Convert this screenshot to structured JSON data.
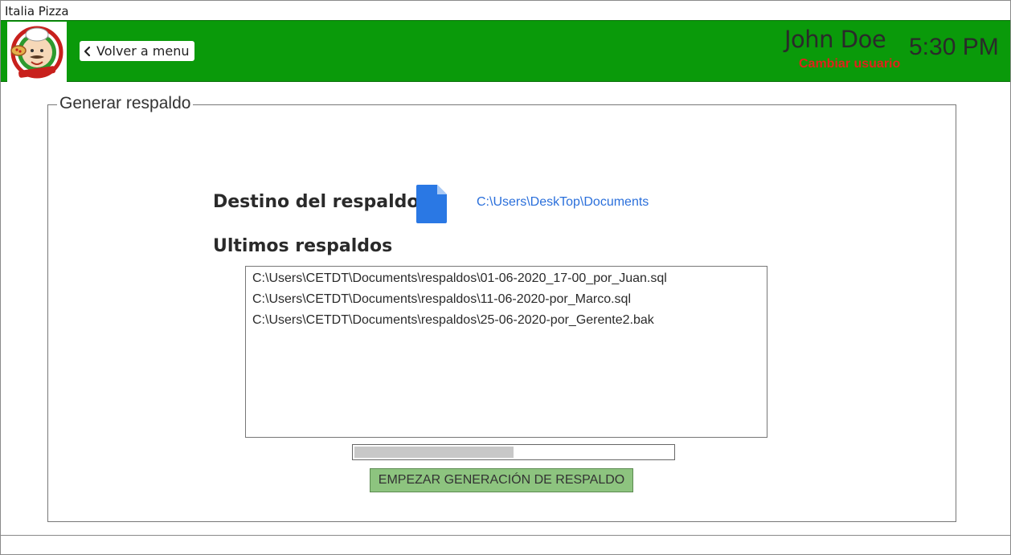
{
  "window": {
    "title": "Italia Pizza"
  },
  "header": {
    "back_label": "Volver a menu",
    "user_name": "John Doe",
    "change_user_label": "Cambiar usuario",
    "time": "5:30 PM",
    "bg_color": "#0a9a0a"
  },
  "groupbox": {
    "legend": "Generar respaldo"
  },
  "destination": {
    "label": "Destino del respaldo",
    "icon": "file-icon",
    "path": "C:\\Users\\DeskTop\\Documents"
  },
  "recent": {
    "label": "Ultimos respaldos",
    "items": [
      "C:\\Users\\CETDT\\Documents\\respaldos\\01-06-2020_17-00_por_Juan.sql",
      "C:\\Users\\CETDT\\Documents\\respaldos\\11-06-2020-por_Marco.sql",
      "C:\\Users\\CETDT\\Documents\\respaldos\\25-06-2020-por_Gerente2.bak"
    ]
  },
  "progress": {
    "value": 0.5
  },
  "actions": {
    "start_label": "EMPEZAR GENERACIÓN DE RESPALDO",
    "start_color": "#8dc47f"
  },
  "colors": {
    "link": "#2a6fdb",
    "danger": "#e0221a",
    "icon_blue": "#2a78e4"
  }
}
